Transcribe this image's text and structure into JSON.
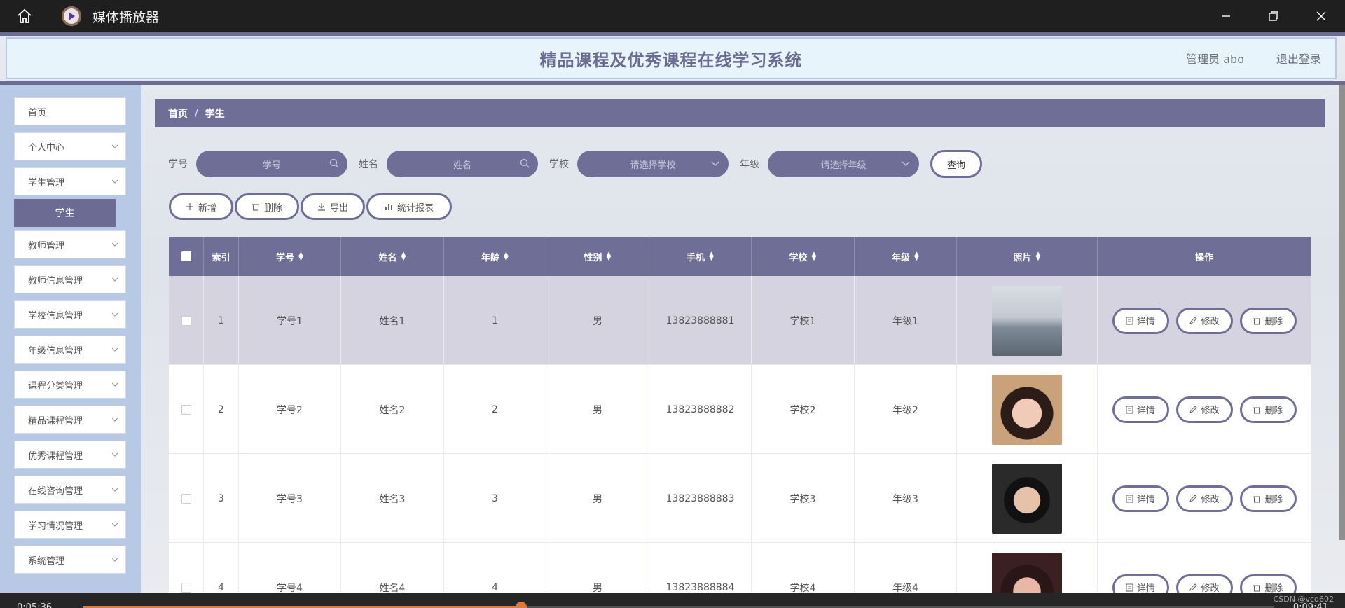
{
  "window": {
    "title": "媒体播放器",
    "icons": {
      "home": "home-icon",
      "app": "play-icon",
      "minimize": "minimize-icon",
      "restore": "restore-icon",
      "close": "close-icon"
    }
  },
  "header": {
    "title": "精品课程及优秀课程在线学习系统",
    "user": "管理员 abo",
    "logout": "退出登录"
  },
  "sidebar": {
    "items": [
      {
        "label": "首页",
        "chevron": false
      },
      {
        "label": "个人中心",
        "chevron": true
      },
      {
        "label": "学生管理",
        "chevron": true
      },
      {
        "label": "学生",
        "sub": true
      },
      {
        "label": "教师管理",
        "chevron": true
      },
      {
        "label": "教师信息管理",
        "chevron": true
      },
      {
        "label": "学校信息管理",
        "chevron": true
      },
      {
        "label": "年级信息管理",
        "chevron": true
      },
      {
        "label": "课程分类管理",
        "chevron": true
      },
      {
        "label": "精品课程管理",
        "chevron": true
      },
      {
        "label": "优秀课程管理",
        "chevron": true
      },
      {
        "label": "在线咨询管理",
        "chevron": true
      },
      {
        "label": "学习情况管理",
        "chevron": true
      },
      {
        "label": "系统管理",
        "chevron": true
      }
    ]
  },
  "breadcrumb": {
    "home": "首页",
    "separator": "/",
    "current": "学生"
  },
  "search": {
    "xuehao_label": "学号",
    "xuehao_placeholder": "学号",
    "xingming_label": "姓名",
    "xingming_placeholder": "姓名",
    "xuexiao_label": "学校",
    "xuexiao_placeholder": "请选择学校",
    "nianji_label": "年级",
    "nianji_placeholder": "请选择年级",
    "query_button": "查询"
  },
  "actions": {
    "add": "新增",
    "delete": "删除",
    "export": "导出",
    "report": "统计报表"
  },
  "table": {
    "headers": {
      "index": "索引",
      "xuehao": "学号",
      "xingming": "姓名",
      "age": "年龄",
      "gender": "性别",
      "phone": "手机",
      "school": "学校",
      "grade": "年级",
      "photo": "照片",
      "ops": "操作"
    },
    "op_labels": {
      "detail": "详情",
      "edit": "修改",
      "delete": "删除"
    },
    "rows": [
      {
        "index": "1",
        "xuehao": "学号1",
        "xingming": "姓名1",
        "age": "1",
        "gender": "男",
        "phone": "13823888881",
        "school": "学校1",
        "grade": "年级1"
      },
      {
        "index": "2",
        "xuehao": "学号2",
        "xingming": "姓名2",
        "age": "2",
        "gender": "男",
        "phone": "13823888882",
        "school": "学校2",
        "grade": "年级2"
      },
      {
        "index": "3",
        "xuehao": "学号3",
        "xingming": "姓名3",
        "age": "3",
        "gender": "男",
        "phone": "13823888883",
        "school": "学校3",
        "grade": "年级3"
      },
      {
        "index": "4",
        "xuehao": "学号4",
        "xingming": "姓名4",
        "age": "4",
        "gender": "男",
        "phone": "13823888884",
        "school": "学校4",
        "grade": "年级4"
      }
    ]
  },
  "player": {
    "elapsed": "0:05:36",
    "remaining": "0:09:41",
    "watermark": "CSDN @vcd602",
    "progress": 0.3685
  },
  "colors": {
    "accent": "#6f6e96",
    "sidebar": "#b7c9e5",
    "header_bg": "#e8f4fc",
    "progress": "#e07a3c"
  }
}
